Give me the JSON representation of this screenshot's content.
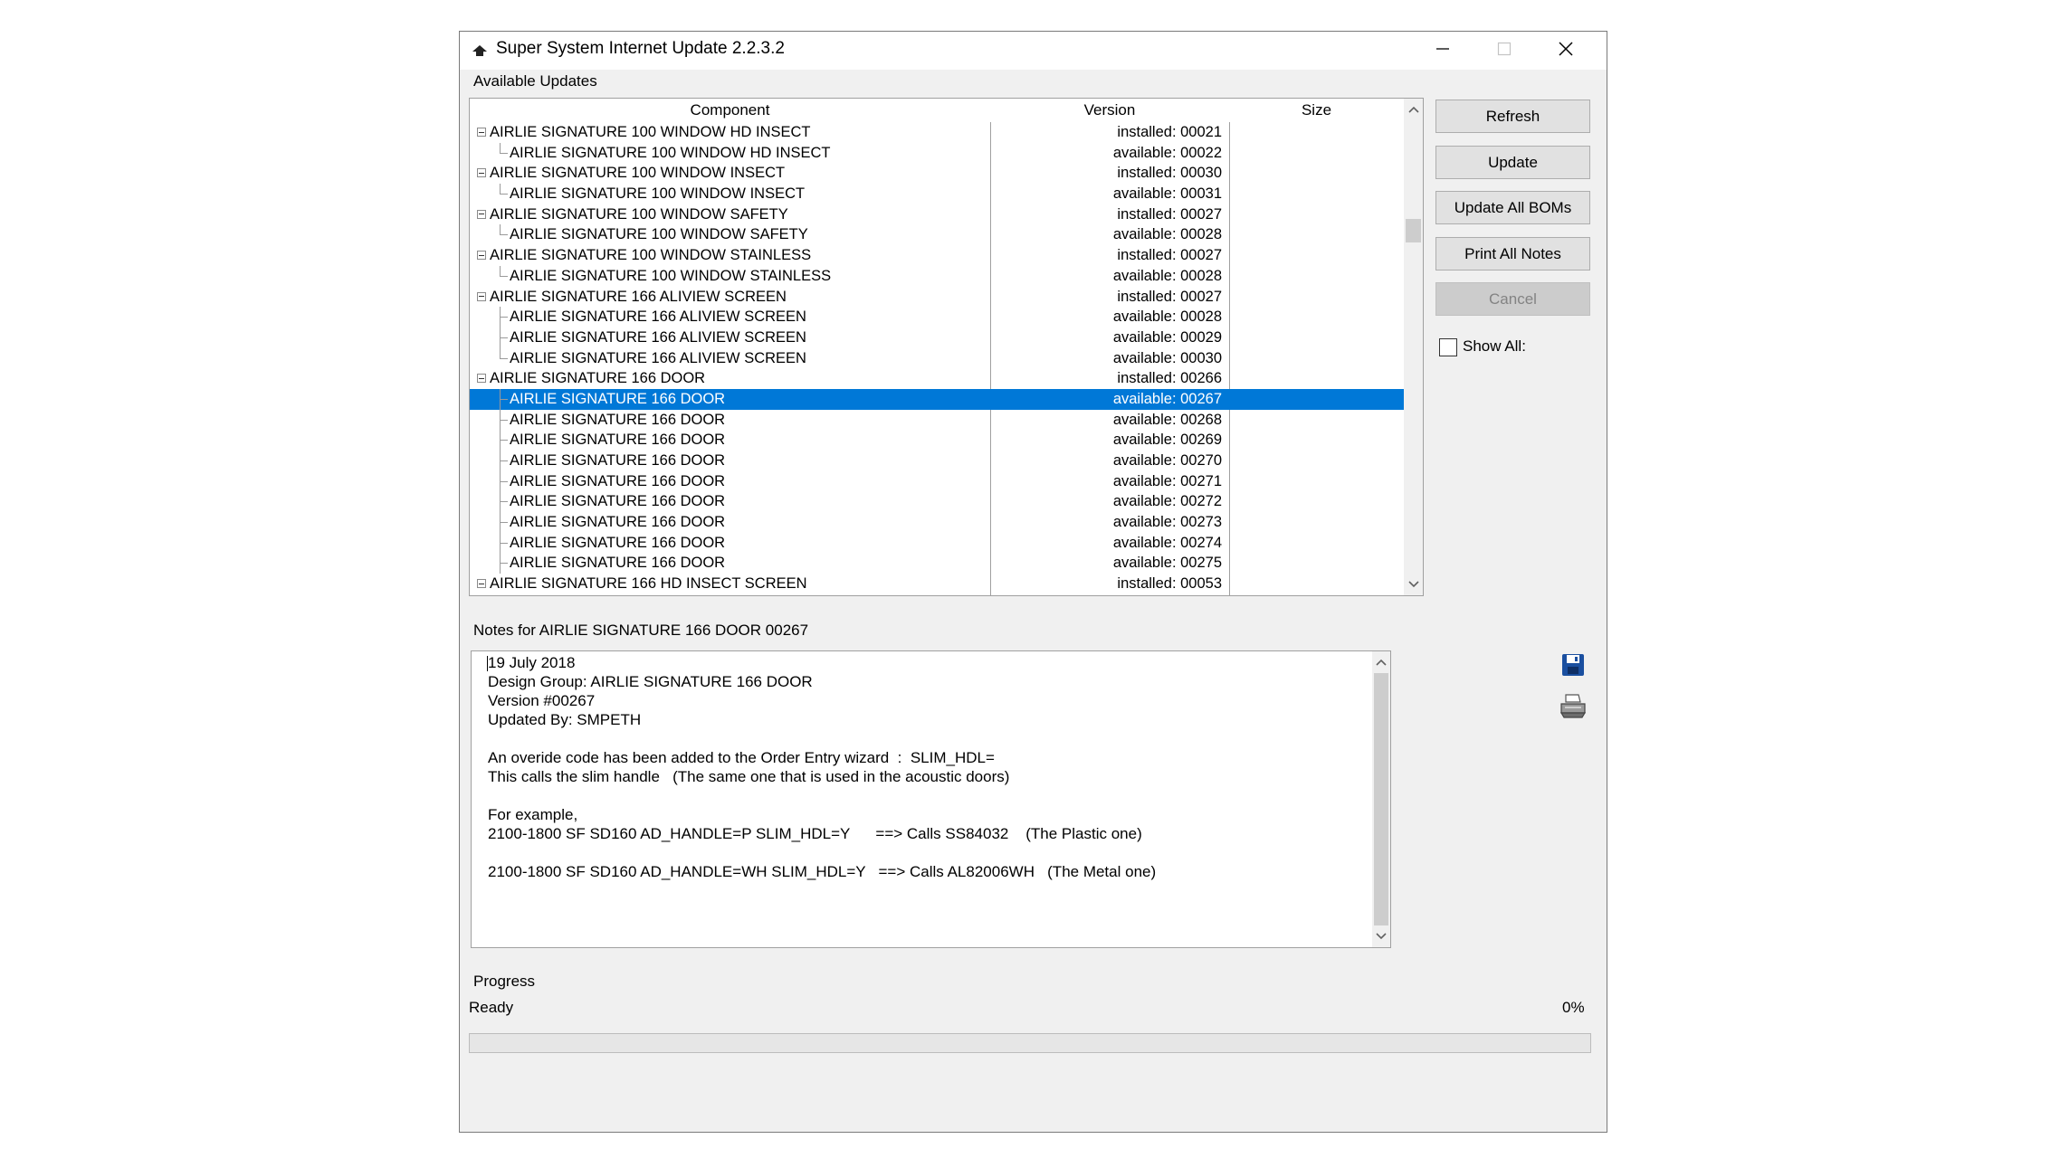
{
  "window": {
    "title": "Super System Internet Update 2.2.3.2"
  },
  "updates": {
    "group_label": "Available Updates",
    "columns": {
      "component": "Component",
      "version": "Version",
      "size": "Size"
    },
    "rows": [
      {
        "name": "AIRLIE SIGNATURE 100 WINDOW HD INSECT",
        "version": "installed: 00021",
        "level": 0
      },
      {
        "name": "AIRLIE SIGNATURE 100 WINDOW HD INSECT",
        "version": "available: 00022",
        "level": 1,
        "last": true
      },
      {
        "name": "AIRLIE SIGNATURE 100 WINDOW INSECT",
        "version": "installed: 00030",
        "level": 0
      },
      {
        "name": "AIRLIE SIGNATURE 100 WINDOW INSECT",
        "version": "available: 00031",
        "level": 1,
        "last": true
      },
      {
        "name": "AIRLIE SIGNATURE 100 WINDOW SAFETY",
        "version": "installed: 00027",
        "level": 0
      },
      {
        "name": "AIRLIE SIGNATURE 100 WINDOW SAFETY",
        "version": "available: 00028",
        "level": 1,
        "last": true
      },
      {
        "name": "AIRLIE SIGNATURE 100 WINDOW STAINLESS",
        "version": "installed: 00027",
        "level": 0
      },
      {
        "name": "AIRLIE SIGNATURE 100 WINDOW STAINLESS",
        "version": "available: 00028",
        "level": 1,
        "last": true
      },
      {
        "name": "AIRLIE SIGNATURE 166 ALIVIEW SCREEN",
        "version": "installed: 00027",
        "level": 0
      },
      {
        "name": "AIRLIE SIGNATURE 166 ALIVIEW SCREEN",
        "version": "available: 00028",
        "level": 1
      },
      {
        "name": "AIRLIE SIGNATURE 166 ALIVIEW SCREEN",
        "version": "available: 00029",
        "level": 1
      },
      {
        "name": "AIRLIE SIGNATURE 166 ALIVIEW SCREEN",
        "version": "available: 00030",
        "level": 1,
        "last": true
      },
      {
        "name": "AIRLIE SIGNATURE 166 DOOR",
        "version": "installed: 00266",
        "level": 0
      },
      {
        "name": "AIRLIE SIGNATURE 166 DOOR",
        "version": "available: 00267",
        "level": 1,
        "selected": true
      },
      {
        "name": "AIRLIE SIGNATURE 166 DOOR",
        "version": "available: 00268",
        "level": 1
      },
      {
        "name": "AIRLIE SIGNATURE 166 DOOR",
        "version": "available: 00269",
        "level": 1
      },
      {
        "name": "AIRLIE SIGNATURE 166 DOOR",
        "version": "available: 00270",
        "level": 1
      },
      {
        "name": "AIRLIE SIGNATURE 166 DOOR",
        "version": "available: 00271",
        "level": 1
      },
      {
        "name": "AIRLIE SIGNATURE 166 DOOR",
        "version": "available: 00272",
        "level": 1
      },
      {
        "name": "AIRLIE SIGNATURE 166 DOOR",
        "version": "available: 00273",
        "level": 1
      },
      {
        "name": "AIRLIE SIGNATURE 166 DOOR",
        "version": "available: 00274",
        "level": 1
      },
      {
        "name": "AIRLIE SIGNATURE 166 DOOR",
        "version": "available: 00275",
        "level": 1
      },
      {
        "name": "AIRLIE SIGNATURE 166 HD INSECT SCREEN",
        "version": "installed: 00053",
        "level": 0
      }
    ]
  },
  "buttons": {
    "refresh": "Refresh",
    "update": "Update",
    "update_all_boms": "Update All BOMs",
    "print_all_notes": "Print All Notes",
    "cancel": "Cancel"
  },
  "show_all": {
    "label": "Show All:",
    "checked": false
  },
  "notes": {
    "group_label": "Notes for AIRLIE SIGNATURE 166 DOOR 00267",
    "lines": [
      "19 July 2018",
      "Design Group: AIRLIE SIGNATURE 166 DOOR",
      "Version #00267",
      "Updated By: SMPETH",
      "",
      "An overide code has been added to the Order Entry wizard  :  SLIM_HDL=",
      "This calls the slim handle   (The same one that is used in the acoustic doors)",
      "",
      "For example,",
      "2100-1800 SF SD160 AD_HANDLE=P SLIM_HDL=Y      ==> Calls SS84032    (The Plastic one)",
      "",
      "2100-1800 SF SD160 AD_HANDLE=WH SLIM_HDL=Y   ==> Calls AL82006WH   (The Metal one)"
    ]
  },
  "progress": {
    "group_label": "Progress",
    "status": "Ready",
    "percent_text": "0%",
    "value": 0
  },
  "colors": {
    "selection": "#0078d7",
    "window_bg": "#f0f0f0",
    "save_icon": "#1a4fa0"
  },
  "icons": {
    "app": "app-icon",
    "save": "save-icon",
    "print": "print-icon"
  }
}
